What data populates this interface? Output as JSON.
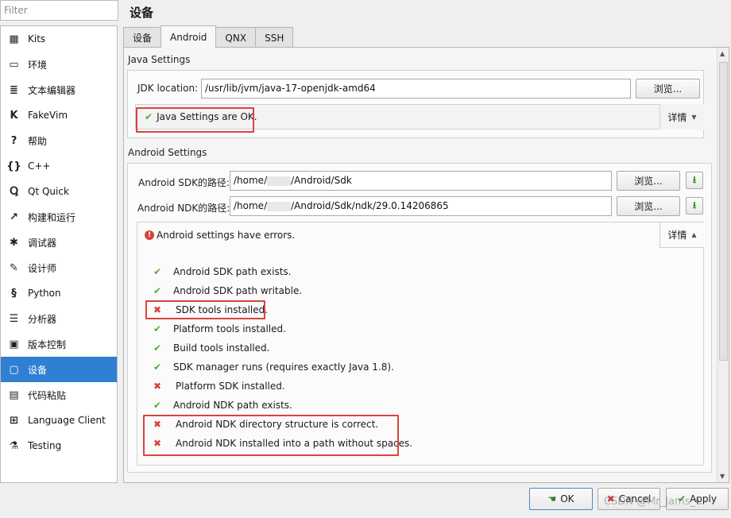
{
  "filter": {
    "placeholder": "Filter"
  },
  "sidebar": {
    "items": [
      {
        "label": "Kits",
        "icon": "kits-icon",
        "glyph": "▦"
      },
      {
        "label": "环境",
        "icon": "monitor-icon",
        "glyph": "▭"
      },
      {
        "label": "文本编辑器",
        "icon": "text-editor-icon",
        "glyph": "≣"
      },
      {
        "label": "FakeVim",
        "icon": "fakevim-icon",
        "glyph": "K"
      },
      {
        "label": "帮助",
        "icon": "help-icon",
        "glyph": "?"
      },
      {
        "label": "C++",
        "icon": "braces-icon",
        "glyph": "{}"
      },
      {
        "label": "Qt Quick",
        "icon": "qt-quick-icon",
        "glyph": "Ⴓ"
      },
      {
        "label": "构建和运行",
        "icon": "hammer-icon",
        "glyph": "↗"
      },
      {
        "label": "调试器",
        "icon": "bug-icon",
        "glyph": "✱"
      },
      {
        "label": "设计师",
        "icon": "pencil-icon",
        "glyph": "✎"
      },
      {
        "label": "Python",
        "icon": "python-icon",
        "glyph": "§"
      },
      {
        "label": "分析器",
        "icon": "analyzer-icon",
        "glyph": "☰"
      },
      {
        "label": "版本控制",
        "icon": "version-control-icon",
        "glyph": "▣"
      },
      {
        "label": "设备",
        "icon": "devices-icon",
        "glyph": "▢"
      },
      {
        "label": "代码粘贴",
        "icon": "code-paste-icon",
        "glyph": "▤"
      },
      {
        "label": "Language Client",
        "icon": "language-client-icon",
        "glyph": "⊞"
      },
      {
        "label": "Testing",
        "icon": "testing-icon",
        "glyph": "⚗"
      }
    ],
    "selected": "设备"
  },
  "page": {
    "title": "设备"
  },
  "tabs": [
    {
      "label": "设备",
      "active": false
    },
    {
      "label": "Android",
      "active": true
    },
    {
      "label": "QNX",
      "active": false
    },
    {
      "label": "SSH",
      "active": false
    }
  ],
  "java": {
    "section_title": "Java Settings",
    "jdk_label": "JDK location:",
    "jdk_value": "/usr/lib/jvm/java-17-openjdk-amd64",
    "browse": "浏览...",
    "status": "Java Settings are OK.",
    "details": "详情"
  },
  "android": {
    "section_title": "Android Settings",
    "sdk_label": "Android SDK的路径:",
    "sdk_value_prefix": "/home/",
    "sdk_value_suffix": "/Android/Sdk",
    "ndk_label": "Android NDK的路径:",
    "ndk_value_prefix": "/home/",
    "ndk_value_suffix": "/Android/Sdk/ndk/29.0.14206865",
    "browse": "浏览...",
    "status": "Android settings have errors.",
    "details": "详情",
    "checks": [
      {
        "label": "Android SDK path exists.",
        "ok": true
      },
      {
        "label": "Android SDK path writable.",
        "ok": true
      },
      {
        "label": "SDK tools installed.",
        "ok": false
      },
      {
        "label": "Platform tools installed.",
        "ok": true
      },
      {
        "label": "Build tools installed.",
        "ok": true
      },
      {
        "label": "SDK manager runs (requires exactly Java 1.8).",
        "ok": true
      },
      {
        "label": "Platform SDK installed.",
        "ok": false
      },
      {
        "label": "Android NDK path exists.",
        "ok": true
      },
      {
        "label": "Android NDK directory structure is correct.",
        "ok": false
      },
      {
        "label": "Android NDK installed into a path without spaces.",
        "ok": false
      }
    ]
  },
  "footer": {
    "ok": "OK",
    "cancel": "Cancel",
    "apply": "Apply"
  },
  "watermark": "CSDN @Mr_Jams_C",
  "colors": {
    "accent": "#2f7fd3",
    "ok": "#5aa83c",
    "error": "#d6423a",
    "highlight": "#d9443f"
  }
}
